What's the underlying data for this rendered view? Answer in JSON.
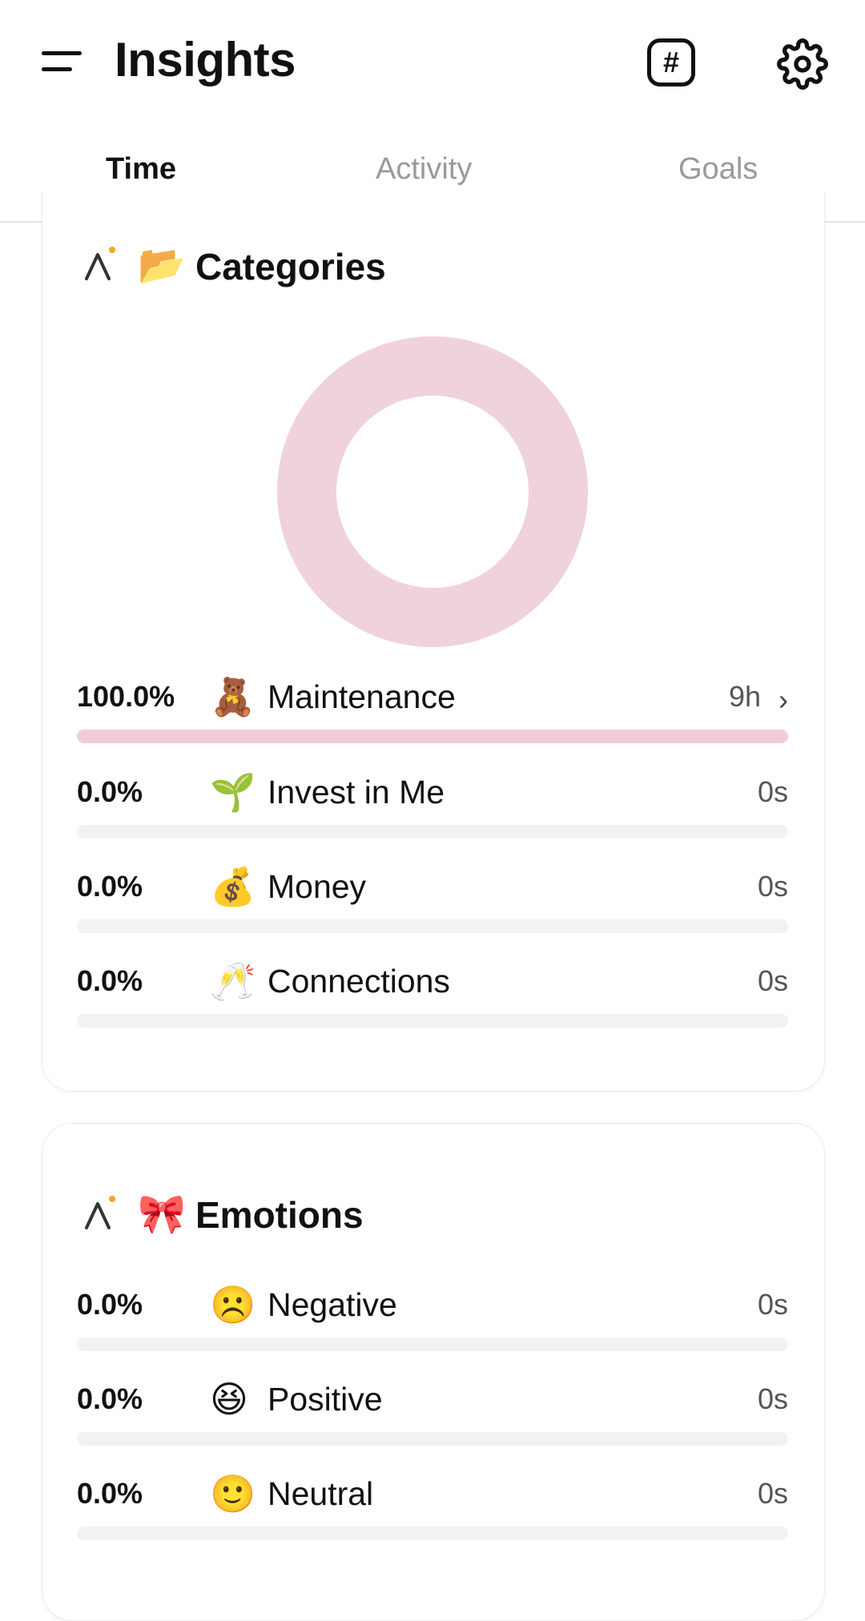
{
  "header": {
    "title": "Insights",
    "hash_icon": "hashtag-icon",
    "settings_icon": "gear-icon"
  },
  "tabs": [
    {
      "label": "Time",
      "active": true
    },
    {
      "label": "Activity",
      "active": false
    },
    {
      "label": "Goals",
      "active": false
    }
  ],
  "categories": {
    "emoji": "📂",
    "title": "Categories",
    "donut_color": "#f0d3da",
    "items": [
      {
        "pct": "100.0%",
        "emoji": "🧸",
        "label": "Maintenance",
        "duration": "9h",
        "fill": 1.0,
        "chevron": "›"
      },
      {
        "pct": "0.0%",
        "emoji": "🌱",
        "label": "Invest in Me",
        "duration": "0s",
        "fill": 0.0
      },
      {
        "pct": "0.0%",
        "emoji": "💰",
        "label": "Money",
        "duration": "0s",
        "fill": 0.0
      },
      {
        "pct": "0.0%",
        "emoji": "🥂",
        "label": "Connections",
        "duration": "0s",
        "fill": 0.0
      }
    ]
  },
  "emotions": {
    "emoji": "🎀",
    "title": "Emotions",
    "items": [
      {
        "pct": "0.0%",
        "emoji": "☹️",
        "label": "Negative",
        "duration": "0s",
        "fill": 0.0
      },
      {
        "pct": "0.0%",
        "emoji": "😆",
        "label": "Positive",
        "duration": "0s",
        "fill": 0.0
      },
      {
        "pct": "0.0%",
        "emoji": "🙂",
        "label": "Neutral",
        "duration": "0s",
        "fill": 0.0
      }
    ]
  }
}
